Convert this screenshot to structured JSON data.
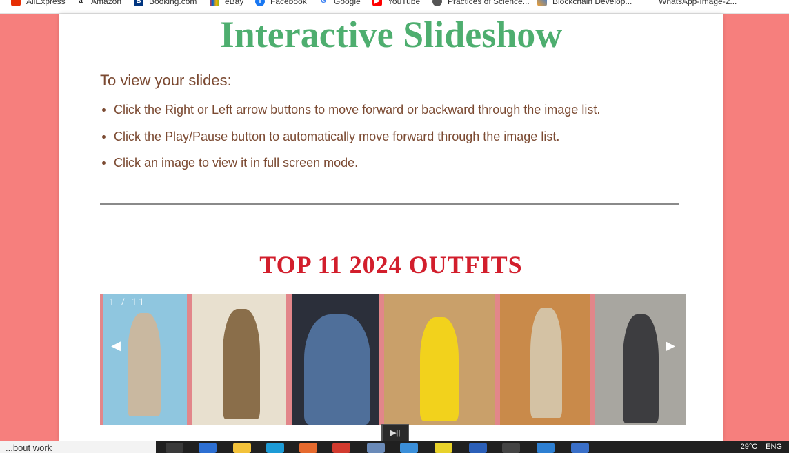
{
  "bookmarks": [
    {
      "label": "AliExpress",
      "icon": "aliexpress-icon",
      "color": "#e62e04"
    },
    {
      "label": "Amazon",
      "icon": "amazon-icon",
      "color": "#222222"
    },
    {
      "label": "Booking.com",
      "icon": "booking-icon",
      "color": "#003580"
    },
    {
      "label": "eBay",
      "icon": "ebay-icon",
      "color": "#e53238"
    },
    {
      "label": "Facebook",
      "icon": "facebook-icon",
      "color": "#1877f2"
    },
    {
      "label": "Google",
      "icon": "google-icon",
      "color": "#4285f4"
    },
    {
      "label": "YouTube",
      "icon": "youtube-icon",
      "color": "#ff0000"
    },
    {
      "label": "Practices of Science...",
      "icon": "globe-icon",
      "color": "#555555"
    },
    {
      "label": "Blockchain Develop...",
      "icon": "blockchain-icon",
      "color": "#f0a030"
    },
    {
      "label": "WhatsApp-Image-2...",
      "icon": "",
      "color": ""
    }
  ],
  "page": {
    "title": "Interactive Slideshow",
    "howto_heading": "To view your slides:",
    "instructions": [
      "Click the Right or Left arrow buttons to move forward or backward through the image list.",
      "Click the Play/Pause button to automatically move forward through the image list.",
      "Click an image to view it in full screen mode."
    ],
    "section_title": "TOP 11 2024 OUTFITS"
  },
  "slideshow": {
    "counter": "1 / 11",
    "prev_label": "◀",
    "next_label": "▶",
    "play_pause_label": "▶||",
    "slides": [
      {
        "name": "slide-1",
        "bg": "#8fc6df",
        "figure": "#c9b8a0"
      },
      {
        "name": "slide-2",
        "bg": "#e8e0cf",
        "figure": "#8a6e4a"
      },
      {
        "name": "slide-3",
        "bg": "#2b2f3a",
        "figure": "#4f6f9a"
      },
      {
        "name": "slide-4",
        "bg": "#c9a06a",
        "figure": "#f2d21c"
      },
      {
        "name": "slide-5",
        "bg": "#c98a4a",
        "figure": "#d4c2a4"
      },
      {
        "name": "slide-6",
        "bg": "#a8a6a0",
        "figure": "#3d3d40"
      }
    ]
  },
  "taskbar": {
    "search_text": "...bout work",
    "temperature": "29°C",
    "language": "ENG"
  },
  "colors": {
    "background": "#f67f7d",
    "title": "#4eae6f",
    "body_text": "#7b4a32",
    "section_title": "#d21e2c"
  }
}
